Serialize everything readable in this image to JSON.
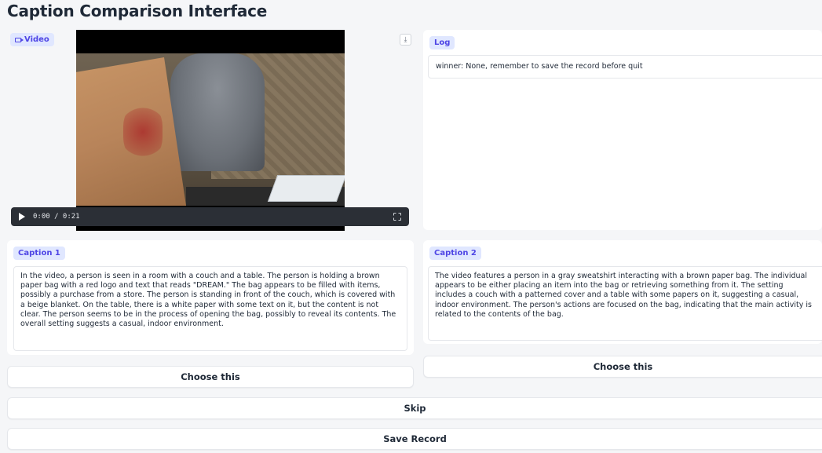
{
  "app": {
    "title": "Caption Comparison Interface"
  },
  "video": {
    "label": "Video",
    "label_icon": "video-camera-icon",
    "time": "0:00 / 0:21",
    "download_icon": "download-icon"
  },
  "log": {
    "label": "Log",
    "text": "winner: None, remember to save the record before quit"
  },
  "caption1": {
    "label": "Caption 1",
    "text": "In the video, a person is seen in a room with a couch and a table. The person is holding a brown paper bag with a red logo and text that reads \"DREAM.\" The bag appears to be filled with items, possibly a purchase from a store. The person is standing in front of the couch, which is covered with a beige blanket. On the table, there is a white paper with some text on it, but the content is not clear. The person seems to be in the process of opening the bag, possibly to reveal its contents. The overall setting suggests a casual, indoor environment.",
    "button": "Choose this"
  },
  "caption2": {
    "label": "Caption 2",
    "text": "The video features a person in a gray sweatshirt interacting with a brown paper bag. The individual appears to be either placing an item into the bag or retrieving something from it. The setting includes a couch with a patterned cover and a table with some papers on it, suggesting a casual, indoor environment. The person's actions are focused on the bag, indicating that the main activity is related to the contents of the bag.",
    "button": "Choose this"
  },
  "actions": {
    "skip": "Skip",
    "save": "Save Record"
  },
  "colors": {
    "accent": "#4f46e5",
    "chip_bg": "#e0e7ff",
    "page_bg": "#f5f6f8"
  }
}
